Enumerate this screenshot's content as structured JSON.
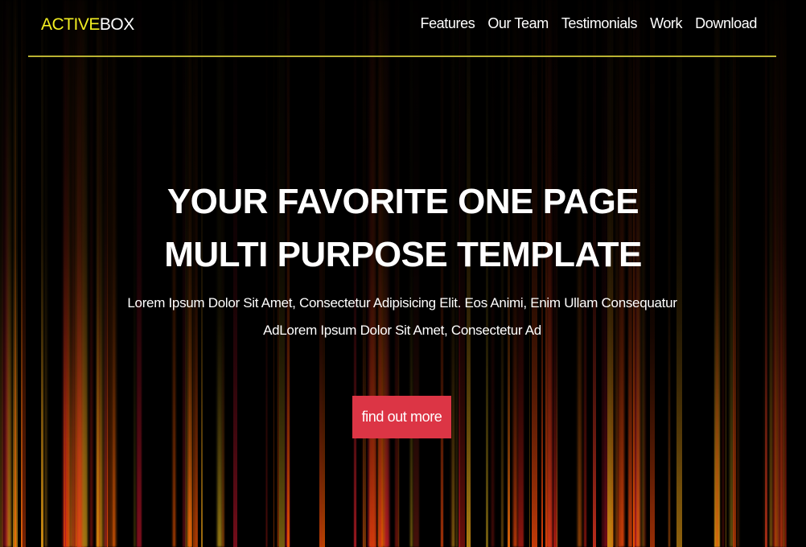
{
  "navbar": {
    "brand_part1": "ACTIVE",
    "brand_part2": "BOX",
    "items": [
      "Features",
      "Our Team",
      "Testimonials",
      "Work",
      "Download"
    ]
  },
  "hero": {
    "headline_line1": "YOUR FAVORITE ONE PAGE",
    "headline_line2": "MULTI PURPOSE TEMPLATE",
    "lead_line1": "Lorem Ipsum Dolor Sit Amet, Consectetur Adipisicing Elit. Eos Animi, Enim Ullam Consequatur",
    "lead_line2": "AdLorem Ipsum Dolor Sit Amet, Consectetur Ad",
    "cta_label": "find out more"
  },
  "colors": {
    "brand_accent": "#f2ee22",
    "nav_divider": "#b9b232",
    "cta_background": "#dc3545",
    "background": "#000000"
  }
}
